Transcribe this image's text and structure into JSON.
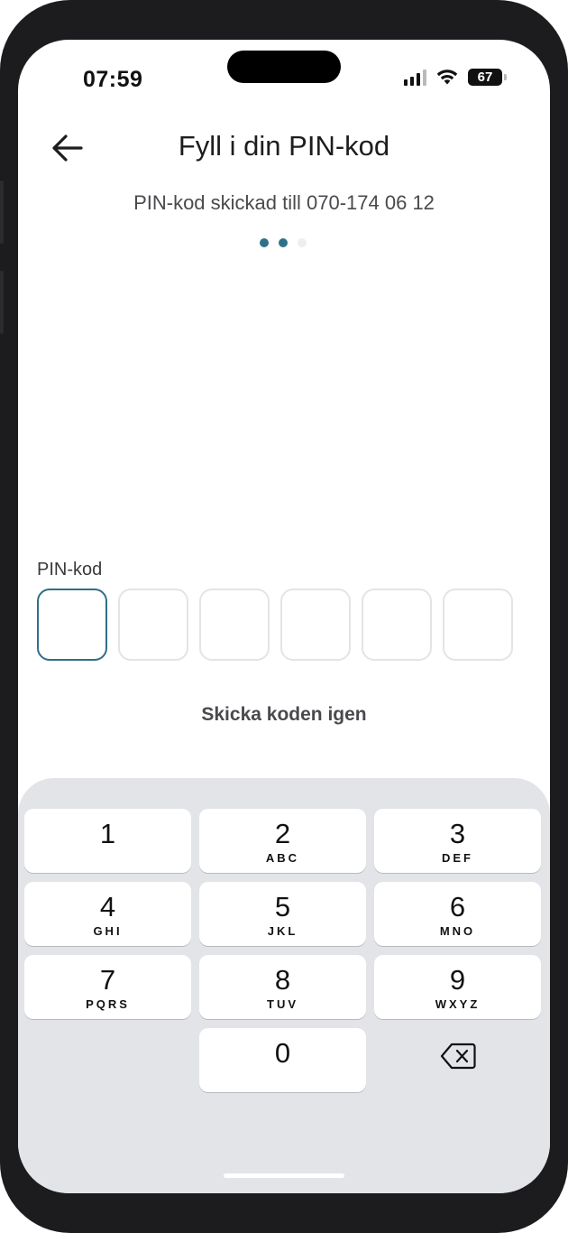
{
  "status_bar": {
    "time": "07:59",
    "battery": "67"
  },
  "header": {
    "title": "Fyll i din PIN-kod"
  },
  "subtitle": "PIN-kod skickad till 070-174 06 12",
  "progress": {
    "step": 2,
    "total": 3,
    "active_color": "#2f7288",
    "inactive_color": "#eceef0"
  },
  "pin": {
    "label": "PIN-kod",
    "length": 6,
    "active_index": 0,
    "active_border": "#2f6f87"
  },
  "resend_label": "Skicka koden igen",
  "keypad": {
    "keys": [
      {
        "digit": "1",
        "letters": ""
      },
      {
        "digit": "2",
        "letters": "ABC"
      },
      {
        "digit": "3",
        "letters": "DEF"
      },
      {
        "digit": "4",
        "letters": "GHI"
      },
      {
        "digit": "5",
        "letters": "JKL"
      },
      {
        "digit": "6",
        "letters": "MNO"
      },
      {
        "digit": "7",
        "letters": "PQRS"
      },
      {
        "digit": "8",
        "letters": "TUV"
      },
      {
        "digit": "9",
        "letters": "WXYZ"
      },
      {
        "digit": "0",
        "letters": ""
      }
    ],
    "delete_icon": "backspace-icon"
  }
}
